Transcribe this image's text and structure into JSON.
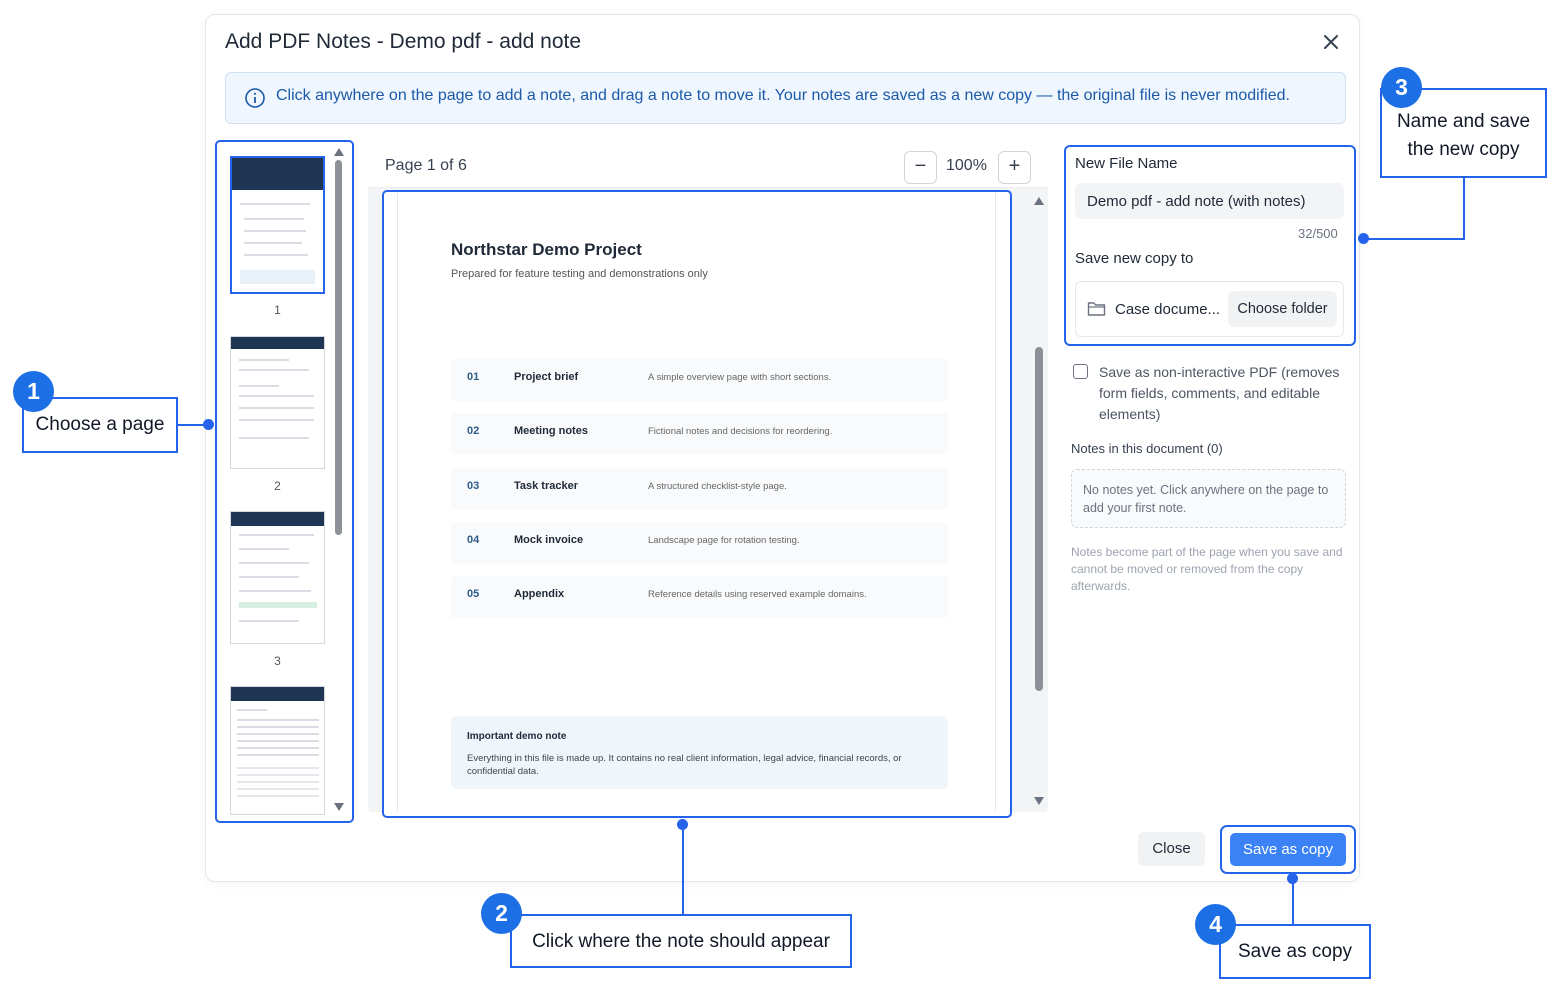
{
  "dialog": {
    "title": "Add PDF Notes - Demo pdf - add note",
    "info": "Click anywhere on the page to add a note, and drag a note to move it. Your notes are saved as a new copy — the original file is never modified."
  },
  "thumbnails": [
    "1",
    "2",
    "3"
  ],
  "viewer": {
    "page_label": "Page 1 of 6",
    "zoom_out": "−",
    "zoom": "100%",
    "zoom_in": "+"
  },
  "document": {
    "title": "Northstar Demo Project",
    "subtitle": "Prepared for feature testing and demonstrations only",
    "rows": [
      {
        "num": "01",
        "title": "Project brief",
        "desc": "A simple overview page with short sections."
      },
      {
        "num": "02",
        "title": "Meeting notes",
        "desc": "Fictional notes and decisions for reordering."
      },
      {
        "num": "03",
        "title": "Task tracker",
        "desc": "A structured checklist-style page."
      },
      {
        "num": "04",
        "title": "Mock invoice",
        "desc": "Landscape page for rotation testing."
      },
      {
        "num": "05",
        "title": "Appendix",
        "desc": "Reference details using reserved example domains."
      }
    ],
    "note_title": "Important demo note",
    "note_body": "Everything in this file is made up. It contains no real client information, legal advice, financial records, or confidential data."
  },
  "panel": {
    "new_file_label": "New File Name",
    "new_file_value": "Demo pdf - add note (with notes)",
    "char_count": "32/500",
    "save_to_label": "Save new copy to",
    "folder_name": "Case docume...",
    "choose_folder": "Choose folder",
    "checkbox_label": "Save as non-interactive PDF (removes form fields, comments, and editable elements)",
    "notes_label": "Notes in this document (0)",
    "notes_empty": "No notes yet. Click anywhere on the page to add your first note.",
    "notes_info": "Notes become part of the page when you save and cannot be moved or removed from the copy afterwards."
  },
  "footer": {
    "close": "Close",
    "save": "Save as copy"
  },
  "callouts": [
    {
      "num": "1",
      "text": "Choose a page"
    },
    {
      "num": "2",
      "text": "Click where the note should appear"
    },
    {
      "num": "3",
      "text": "Name and save the new copy"
    },
    {
      "num": "4",
      "text": "Save as copy"
    }
  ],
  "colors": {
    "accent": "#2563eb",
    "button": "#3b82f6",
    "badge": "#1d6fe6"
  }
}
